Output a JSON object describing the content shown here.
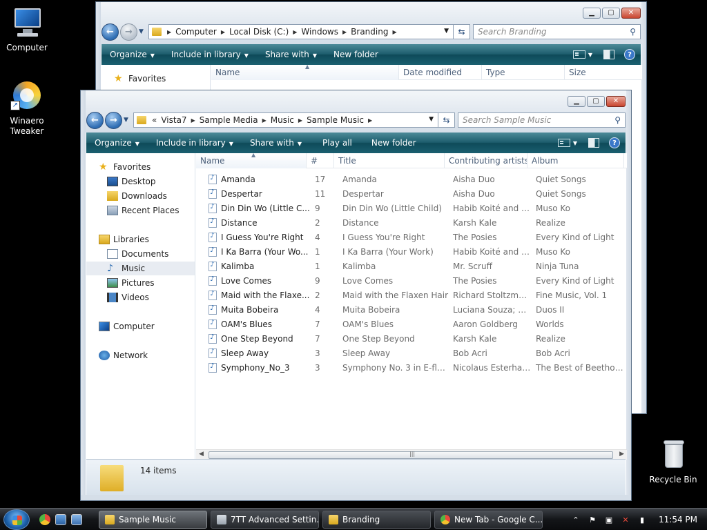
{
  "desktop": {
    "icons": [
      {
        "label": "Computer"
      },
      {
        "label": "Winaero Tweaker"
      },
      {
        "label": "Recycle Bin"
      }
    ]
  },
  "back_window": {
    "path": [
      "Computer",
      "Local Disk (C:)",
      "Windows",
      "Branding"
    ],
    "search_placeholder": "Search Branding",
    "commands": [
      "Organize",
      "Include in library",
      "Share with",
      "New folder"
    ],
    "favorites_label": "Favorites",
    "columns": [
      "Name",
      "Date modified",
      "Type",
      "Size"
    ]
  },
  "front_window": {
    "path": [
      "Vista7",
      "Sample Media",
      "Music",
      "Sample Music"
    ],
    "path_prefix": "«",
    "search_placeholder": "Search Sample Music",
    "commands": [
      "Organize",
      "Include in library",
      "Share with",
      "Play all",
      "New folder"
    ],
    "nav": {
      "favorites": "Favorites",
      "desktop": "Desktop",
      "downloads": "Downloads",
      "recent": "Recent Places",
      "libraries": "Libraries",
      "documents": "Documents",
      "music": "Music",
      "pictures": "Pictures",
      "videos": "Videos",
      "computer": "Computer",
      "network": "Network"
    },
    "columns": [
      "Name",
      "#",
      "Title",
      "Contributing artists",
      "Album"
    ],
    "rows": [
      {
        "name": "Amanda",
        "num": "17",
        "title": "Amanda",
        "artist": "Aisha Duo",
        "album": "Quiet Songs"
      },
      {
        "name": "Despertar",
        "num": "11",
        "title": "Despertar",
        "artist": "Aisha Duo",
        "album": "Quiet Songs"
      },
      {
        "name": "Din Din Wo (Little C...",
        "num": "9",
        "title": "Din Din Wo (Little Child)",
        "artist": "Habib Koité and B...",
        "album": "Muso Ko"
      },
      {
        "name": "Distance",
        "num": "2",
        "title": "Distance",
        "artist": "Karsh Kale",
        "album": "Realize"
      },
      {
        "name": "I Guess You're Right",
        "num": "4",
        "title": "I Guess You're Right",
        "artist": "The Posies",
        "album": "Every Kind of Light"
      },
      {
        "name": "I Ka Barra (Your Wo...",
        "num": "1",
        "title": "I Ka Barra (Your Work)",
        "artist": "Habib Koité and B...",
        "album": "Muso Ko"
      },
      {
        "name": "Kalimba",
        "num": "1",
        "title": "Kalimba",
        "artist": "Mr. Scruff",
        "album": "Ninja Tuna"
      },
      {
        "name": "Love Comes",
        "num": "9",
        "title": "Love Comes",
        "artist": "The Posies",
        "album": "Every Kind of Light"
      },
      {
        "name": "Maid with the Flaxe...",
        "num": "2",
        "title": "Maid with the Flaxen Hair",
        "artist": "Richard Stoltzman...",
        "album": "Fine Music, Vol. 1"
      },
      {
        "name": "Muita Bobeira",
        "num": "4",
        "title": "Muita Bobeira",
        "artist": "Luciana Souza; Ro...",
        "album": "Duos II"
      },
      {
        "name": "OAM's Blues",
        "num": "7",
        "title": "OAM's Blues",
        "artist": "Aaron Goldberg",
        "album": "Worlds"
      },
      {
        "name": "One Step Beyond",
        "num": "7",
        "title": "One Step Beyond",
        "artist": "Karsh Kale",
        "album": "Realize"
      },
      {
        "name": "Sleep Away",
        "num": "3",
        "title": "Sleep Away",
        "artist": "Bob Acri",
        "album": "Bob Acri"
      },
      {
        "name": "Symphony_No_3",
        "num": "3",
        "title": "Symphony No. 3 in E-flat ...",
        "artist": "Nicolaus Esterhaz...",
        "album": "The Best of Beethoven"
      }
    ],
    "item_count": "14 items"
  },
  "taskbar": {
    "buttons": [
      "Sample Music",
      "7TT Advanced Settin...",
      "Branding",
      "New Tab - Google C..."
    ],
    "clock": "11:54 PM"
  },
  "colors": {
    "command_bar": "#1d5d6d",
    "taskbar": "#141619",
    "selection": "#e8ecf2"
  }
}
